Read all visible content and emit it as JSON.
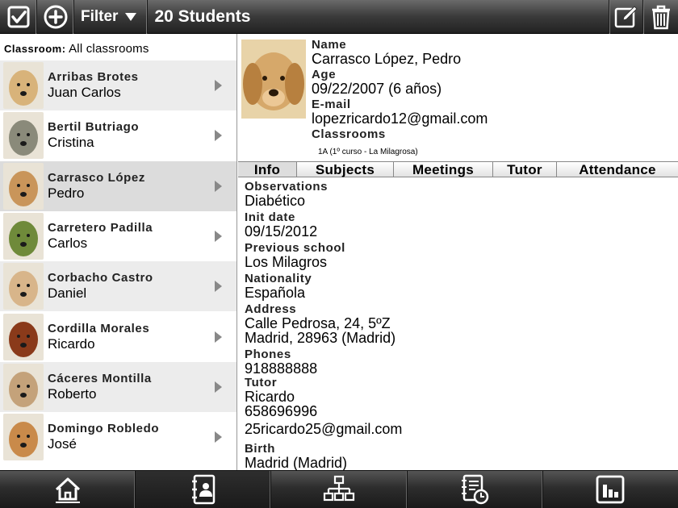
{
  "topbar": {
    "filter_label": "Filter",
    "title": "20 Students",
    "icons": [
      "checkbox-icon",
      "add-circle-icon",
      "filter-triangle-icon",
      "edit-icon",
      "trash-icon"
    ]
  },
  "sidebar": {
    "classroom_key": "Classroom:",
    "classroom_value": "All classrooms",
    "students": [
      {
        "surname": "Arribas Brotes",
        "given": "Juan Carlos",
        "avatar": "#d8b37a"
      },
      {
        "surname": "Bertil Butriago",
        "given": "Cristina",
        "avatar": "#8a8a7a"
      },
      {
        "surname": "Carrasco López",
        "given": "Pedro",
        "avatar": "#c9955a"
      },
      {
        "surname": "Carretero Padilla",
        "given": "Carlos",
        "avatar": "#6f8a3a"
      },
      {
        "surname": "Corbacho Castro",
        "given": "Daniel",
        "avatar": "#d8b58a"
      },
      {
        "surname": "Cordilla Morales",
        "given": "Ricardo",
        "avatar": "#8a3a1a"
      },
      {
        "surname": "Cáceres Montilla",
        "given": "Roberto",
        "avatar": "#c4a27a"
      },
      {
        "surname": "Domingo Robledo",
        "given": "José",
        "avatar": "#c98a4a"
      }
    ]
  },
  "detail": {
    "name_label": "Name",
    "name": "Carrasco López, Pedro",
    "age_label": "Age",
    "age": "09/22/2007 (6 años)",
    "email_label": "E-mail",
    "email": "lopezricardo12@gmail.com",
    "classrooms_label": "Classrooms",
    "classroom": "1A (1º curso - La Milagrosa)",
    "tabs": [
      "Info",
      "Subjects",
      "Meetings",
      "Tutor",
      "Attendance"
    ],
    "info": {
      "observations_label": "Observations",
      "observations": "Diabético",
      "init_label": "Init date",
      "init": "09/15/2012",
      "prev_label": "Previous school",
      "prev": "Los Milagros",
      "nat_label": "Nationality",
      "nat": "Española",
      "addr_label": "Address",
      "addr1": "Calle Pedrosa, 24, 5ºZ",
      "addr2": "Madrid, 28963 (Madrid)",
      "phones_label": "Phones",
      "phones": "918888888",
      "tutor_label": "Tutor",
      "tutor_name": "Ricardo",
      "tutor_phone": "658696996",
      "tutor_email": "25ricardo25@gmail.com",
      "birth_label": "Birth",
      "birth": "Madrid (Madrid)"
    }
  },
  "bottombar": {
    "icons": [
      "home-icon",
      "contacts-book-icon",
      "org-chart-icon",
      "reports-clock-icon",
      "bar-chart-icon"
    ]
  }
}
